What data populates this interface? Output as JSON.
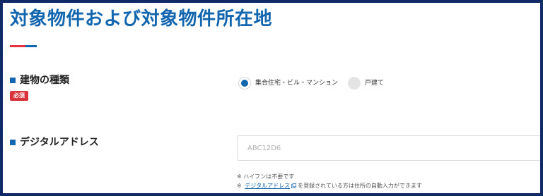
{
  "page": {
    "title": "対象物件および対象物件所在地"
  },
  "colors": {
    "brand_blue": "#1266b0",
    "accent_red": "#e4343d",
    "frame_navy": "#0f2a66"
  },
  "building_type": {
    "label": "建物の種類",
    "required_badge": "必須",
    "options": [
      {
        "label": "集合住宅・ビル・マンション",
        "selected": true
      },
      {
        "label": "戸建て",
        "selected": false
      }
    ]
  },
  "digital_address": {
    "label": "デジタルアドレス",
    "placeholder": "ABC12D6",
    "notes": {
      "prefix1": "※",
      "line1_text": "ハイフンは不要です",
      "prefix2": "※",
      "link_text": "デジタルアドレス",
      "line2_suffix": "を登録されている方は住所の自動入力ができます"
    }
  }
}
